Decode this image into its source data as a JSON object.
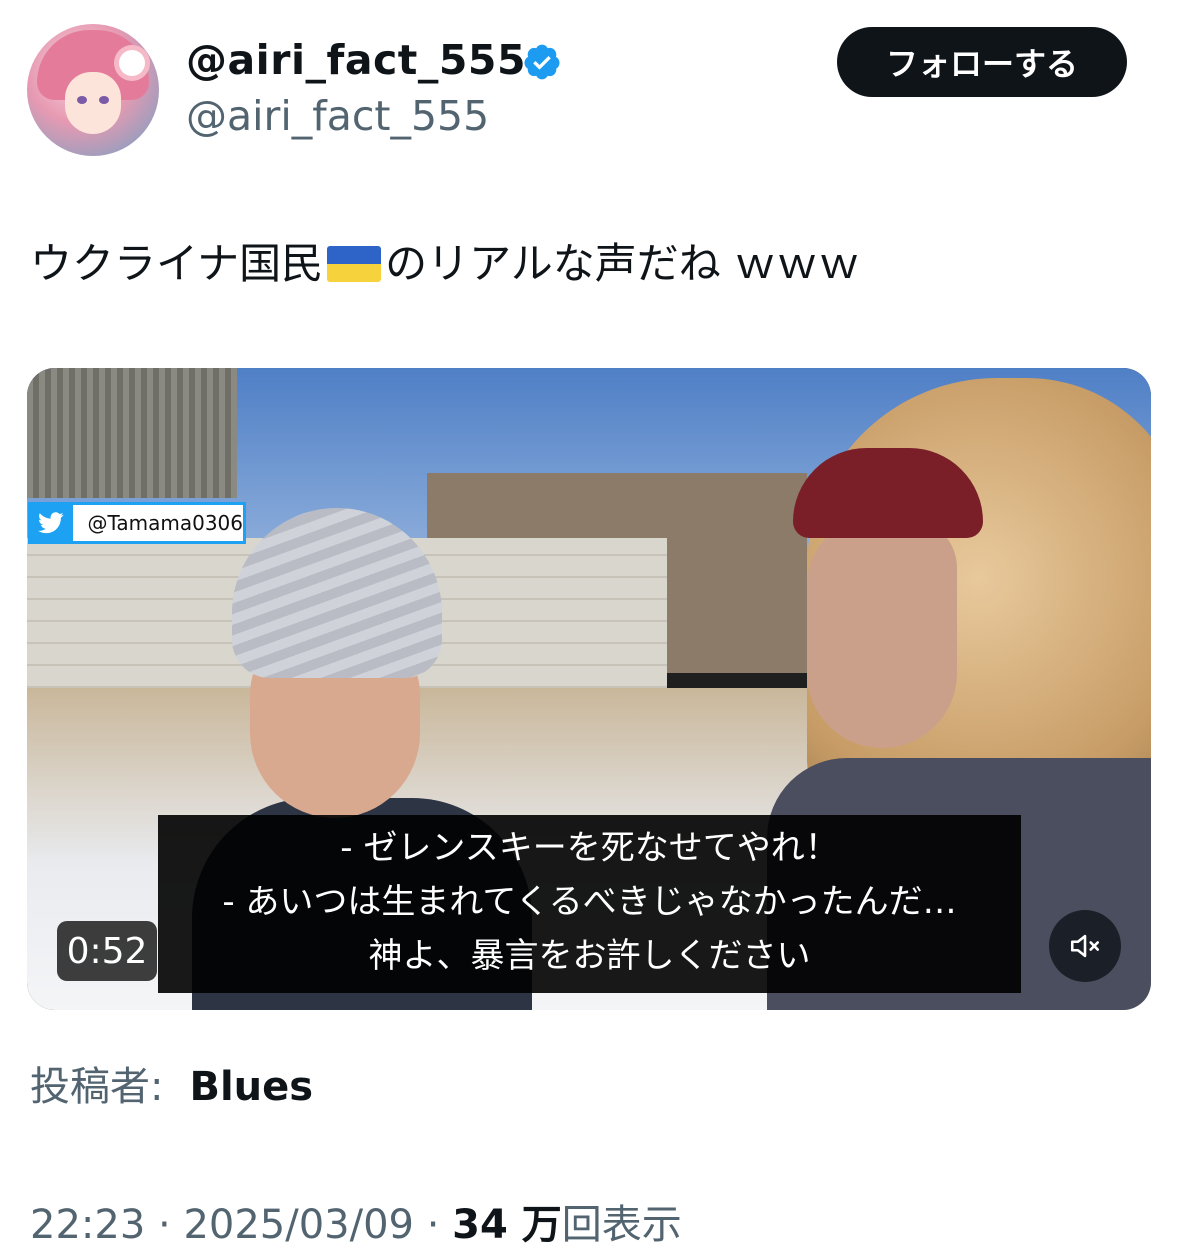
{
  "author": {
    "display_name": "@airi_fact_555",
    "handle": "@airi_fact_555",
    "verified": true,
    "avatar_icon": "anime-girl-avatar"
  },
  "follow_button": {
    "label": "フォローする"
  },
  "tweet": {
    "text_before_flag": "ウクライナ国民",
    "flag_icon": "ukraine-flag",
    "text_after_flag": "のリアルな声だね ｗｗｗ"
  },
  "video": {
    "watermark": "@Tamama0306",
    "subtitles": [
      "- ゼレンスキーを死なせてやれ！",
      "- あいつは生まれてくるべきじゃなかったんだ…",
      "神よ、暴言をお許しください"
    ],
    "time": "0:52",
    "mute_icon": "speaker-muted-icon"
  },
  "posted_by": {
    "label": "投稿者:",
    "user": "Blues"
  },
  "meta": {
    "time": "22:23",
    "sep1": " · ",
    "date": "2025/03/09",
    "sep2": " · ",
    "views_count": "34 万",
    "views_label": "回表示"
  },
  "colors": {
    "text_primary": "#0f1419",
    "text_secondary": "#536471",
    "verified_blue": "#1d9bf0",
    "flag_blue": "#2e63c7",
    "flag_yellow": "#f6d23d"
  }
}
